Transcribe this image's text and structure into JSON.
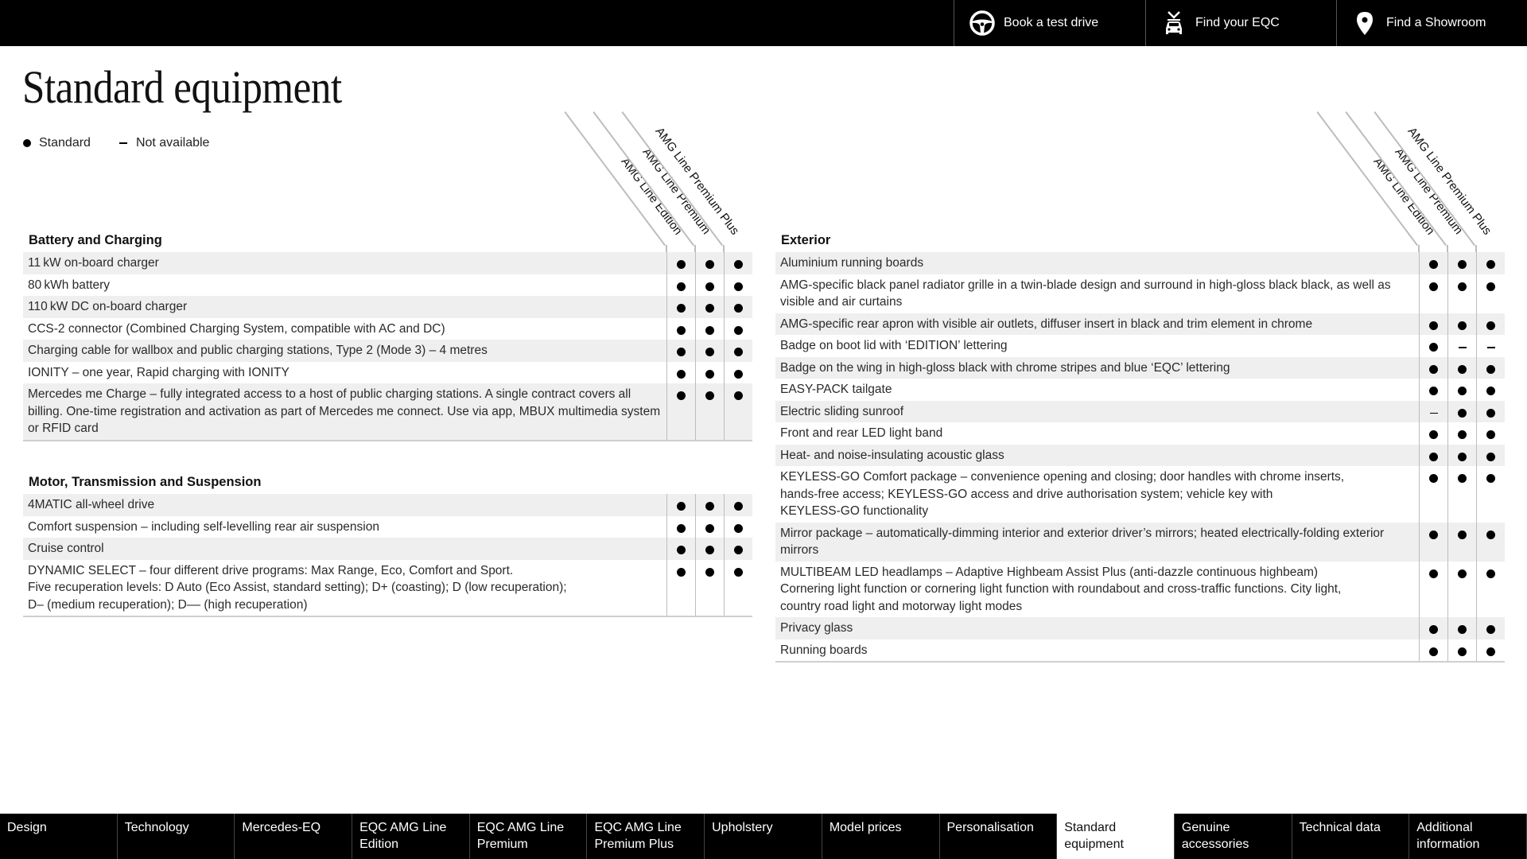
{
  "topbar": {
    "actions": [
      {
        "label": "Book a test drive",
        "icon": "steering-wheel-icon"
      },
      {
        "label": "Find your EQC",
        "icon": "car-search-icon"
      },
      {
        "label": "Find a Showroom",
        "icon": "location-pin-icon"
      }
    ]
  },
  "page": {
    "title": "Standard equipment",
    "legend": {
      "standard": "Standard",
      "not_available": "Not available"
    }
  },
  "columns": [
    "AMG Line Edition",
    "AMG Line Premium",
    "AMG Line Premium Plus"
  ],
  "sections": {
    "battery": {
      "title": "Battery and Charging",
      "rows": [
        {
          "label": "11 kW on-board charger",
          "values": [
            "std",
            "std",
            "std"
          ]
        },
        {
          "label": "80 kWh battery",
          "values": [
            "std",
            "std",
            "std"
          ]
        },
        {
          "label": "110 kW DC on-board charger",
          "values": [
            "std",
            "std",
            "std"
          ]
        },
        {
          "label": "CCS-2 connector (Combined Charging System, compatible with AC and DC)",
          "values": [
            "std",
            "std",
            "std"
          ]
        },
        {
          "label": "Charging cable for wallbox and public charging stations, Type 2 (Mode 3) – 4 metres",
          "values": [
            "std",
            "std",
            "std"
          ]
        },
        {
          "label": "IONITY – one year, Rapid charging with IONITY",
          "values": [
            "std",
            "std",
            "std"
          ]
        },
        {
          "label": "Mercedes me Charge – fully integrated access to a host of public charging stations. A single contract covers all billing. One-time registration and activation as part of Mercedes me connect. Use via app, MBUX multimedia system or RFID card",
          "values": [
            "std",
            "std",
            "std"
          ]
        }
      ]
    },
    "motor": {
      "title": "Motor, Transmission and Suspension",
      "rows": [
        {
          "label": "4MATIC all-wheel drive",
          "values": [
            "std",
            "std",
            "std"
          ]
        },
        {
          "label": "Comfort suspension – including self-levelling rear air suspension",
          "values": [
            "std",
            "std",
            "std"
          ]
        },
        {
          "label": "Cruise control",
          "values": [
            "std",
            "std",
            "std"
          ]
        },
        {
          "label": "DYNAMIC SELECT – four different drive programs: Max Range, Eco, Comfort and Sport.\nFive recuperation levels: D Auto (Eco Assist, standard setting); D+ (coasting); D (low recuperation);\nD– (medium recuperation); D–– (high recuperation)",
          "values": [
            "std",
            "std",
            "std"
          ]
        }
      ]
    },
    "exterior": {
      "title": "Exterior",
      "rows": [
        {
          "label": "Aluminium running boards",
          "values": [
            "std",
            "std",
            "std"
          ]
        },
        {
          "label": "AMG-specific black panel radiator grille in a twin-blade design and surround in high-gloss black black, as well as visible and air curtains",
          "values": [
            "std",
            "std",
            "std"
          ]
        },
        {
          "label": "AMG-specific rear apron with visible air outlets, diffuser insert in black and trim element in chrome",
          "values": [
            "std",
            "std",
            "std"
          ]
        },
        {
          "label": "Badge on boot lid with ‘EDITION’ lettering",
          "values": [
            "std",
            "na",
            "na"
          ]
        },
        {
          "label": "Badge on the wing in high-gloss black with chrome stripes and blue ‘EQC’ lettering",
          "values": [
            "std",
            "std",
            "std"
          ]
        },
        {
          "label": "EASY-PACK tailgate",
          "values": [
            "std",
            "std",
            "std"
          ]
        },
        {
          "label": "Electric sliding sunroof",
          "values": [
            "na",
            "std",
            "std"
          ]
        },
        {
          "label": "Front and rear LED light band",
          "values": [
            "std",
            "std",
            "std"
          ]
        },
        {
          "label": "Heat- and noise-insulating acoustic glass",
          "values": [
            "std",
            "std",
            "std"
          ]
        },
        {
          "label": "KEYLESS-GO Comfort package – convenience opening and closing; door handles with chrome inserts,\nhands-free access; KEYLESS-GO access and drive authorisation system; vehicle key with\nKEYLESS-GO functionality",
          "values": [
            "std",
            "std",
            "std"
          ]
        },
        {
          "label": "Mirror package – automatically-dimming interior and exterior driver’s mirrors; heated electrically-folding exterior mirrors",
          "values": [
            "std",
            "std",
            "std"
          ]
        },
        {
          "label": "MULTIBEAM LED headlamps – Adaptive Highbeam Assist Plus (anti-dazzle continuous highbeam)\nCornering light function or cornering light function with roundabout and cross-traffic functions. City light,\ncountry road light and motorway light modes",
          "values": [
            "std",
            "std",
            "std"
          ]
        },
        {
          "label": "Privacy glass",
          "values": [
            "std",
            "std",
            "std"
          ]
        },
        {
          "label": "Running boards",
          "values": [
            "std",
            "std",
            "std"
          ]
        }
      ]
    }
  },
  "bottomnav": {
    "active_index": 9,
    "tabs": [
      "Design",
      "Technology",
      "Mercedes-EQ",
      "EQC AMG Line Edition",
      "EQC AMG Line Premium",
      "EQC AMG Line Premium Plus",
      "Upholstery",
      "Model prices",
      "Personalisation",
      "Standard equipment",
      "Genuine accessories",
      "Technical data",
      "Additional information"
    ]
  }
}
